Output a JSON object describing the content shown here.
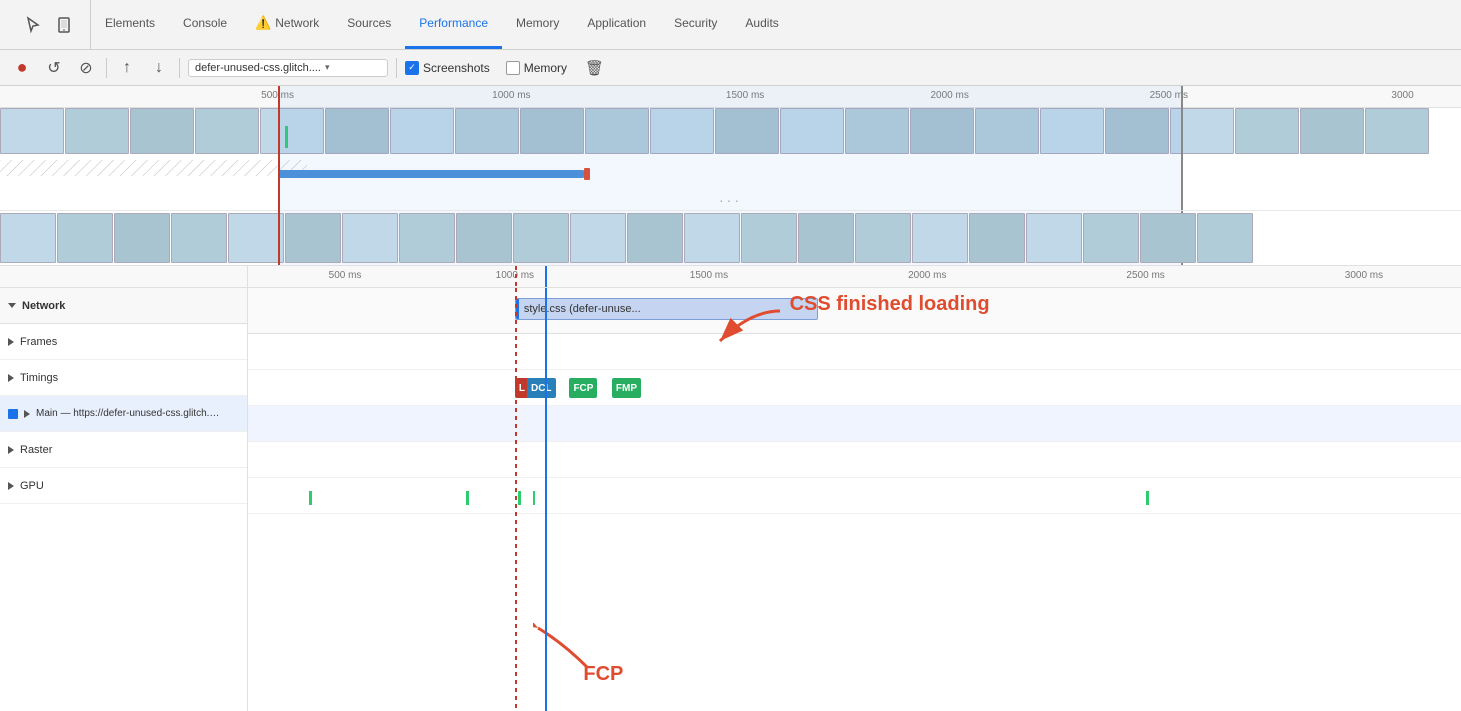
{
  "tabs": {
    "icons": [
      "cursor",
      "device"
    ],
    "items": [
      {
        "label": "Elements",
        "active": false,
        "warn": false
      },
      {
        "label": "Console",
        "active": false,
        "warn": false
      },
      {
        "label": "Network",
        "active": false,
        "warn": true
      },
      {
        "label": "Sources",
        "active": false,
        "warn": false
      },
      {
        "label": "Performance",
        "active": true,
        "warn": false
      },
      {
        "label": "Memory",
        "active": false,
        "warn": false
      },
      {
        "label": "Application",
        "active": false,
        "warn": false
      },
      {
        "label": "Security",
        "active": false,
        "warn": false
      },
      {
        "label": "Audits",
        "active": false,
        "warn": false
      }
    ]
  },
  "toolbar": {
    "record_label": "●",
    "refresh_label": "↺",
    "clear_label": "⊘",
    "upload_label": "↑",
    "download_label": "↓",
    "url_text": "defer-unused-css.glitch....",
    "screenshots_label": "Screenshots",
    "memory_label": "Memory",
    "screenshots_checked": true,
    "memory_checked": false
  },
  "overview_ruler": {
    "marks": [
      "500 ms",
      "1000 ms",
      "1500 ms",
      "2000 ms",
      "2500 ms",
      "3000"
    ]
  },
  "detail_ruler": {
    "marks": [
      "500 ms",
      "1000 ms",
      "1500 ms",
      "2000 ms",
      "2500 ms",
      "3000 ms"
    ]
  },
  "network_section": {
    "label": "Network",
    "css_bar_label": "style.css (defer-unuse...",
    "annotation_text": "CSS finished loading"
  },
  "tracks": [
    {
      "label": "Frames",
      "expanded": false,
      "type": "triangle-right"
    },
    {
      "label": "Timings",
      "expanded": false,
      "type": "triangle-right",
      "badges": [
        "L",
        "DCL",
        "FCP",
        "FMP"
      ]
    },
    {
      "label": "Main — https://defer-unused-css.glitch.me/index-optimized.html",
      "expanded": false,
      "type": "triangle-right",
      "highlighted": true
    },
    {
      "label": "Raster",
      "expanded": false,
      "type": "triangle-right"
    },
    {
      "label": "GPU",
      "expanded": false,
      "type": "triangle-right"
    }
  ],
  "fcp_annotation": "FCP",
  "icons": {
    "cursor": "↖",
    "device": "□",
    "record": "●",
    "refresh": "↺",
    "clear": "⊖",
    "upload": "↑",
    "download": "↓",
    "trash": "🗑",
    "dropdown": "▾",
    "checkmark": "✓"
  }
}
